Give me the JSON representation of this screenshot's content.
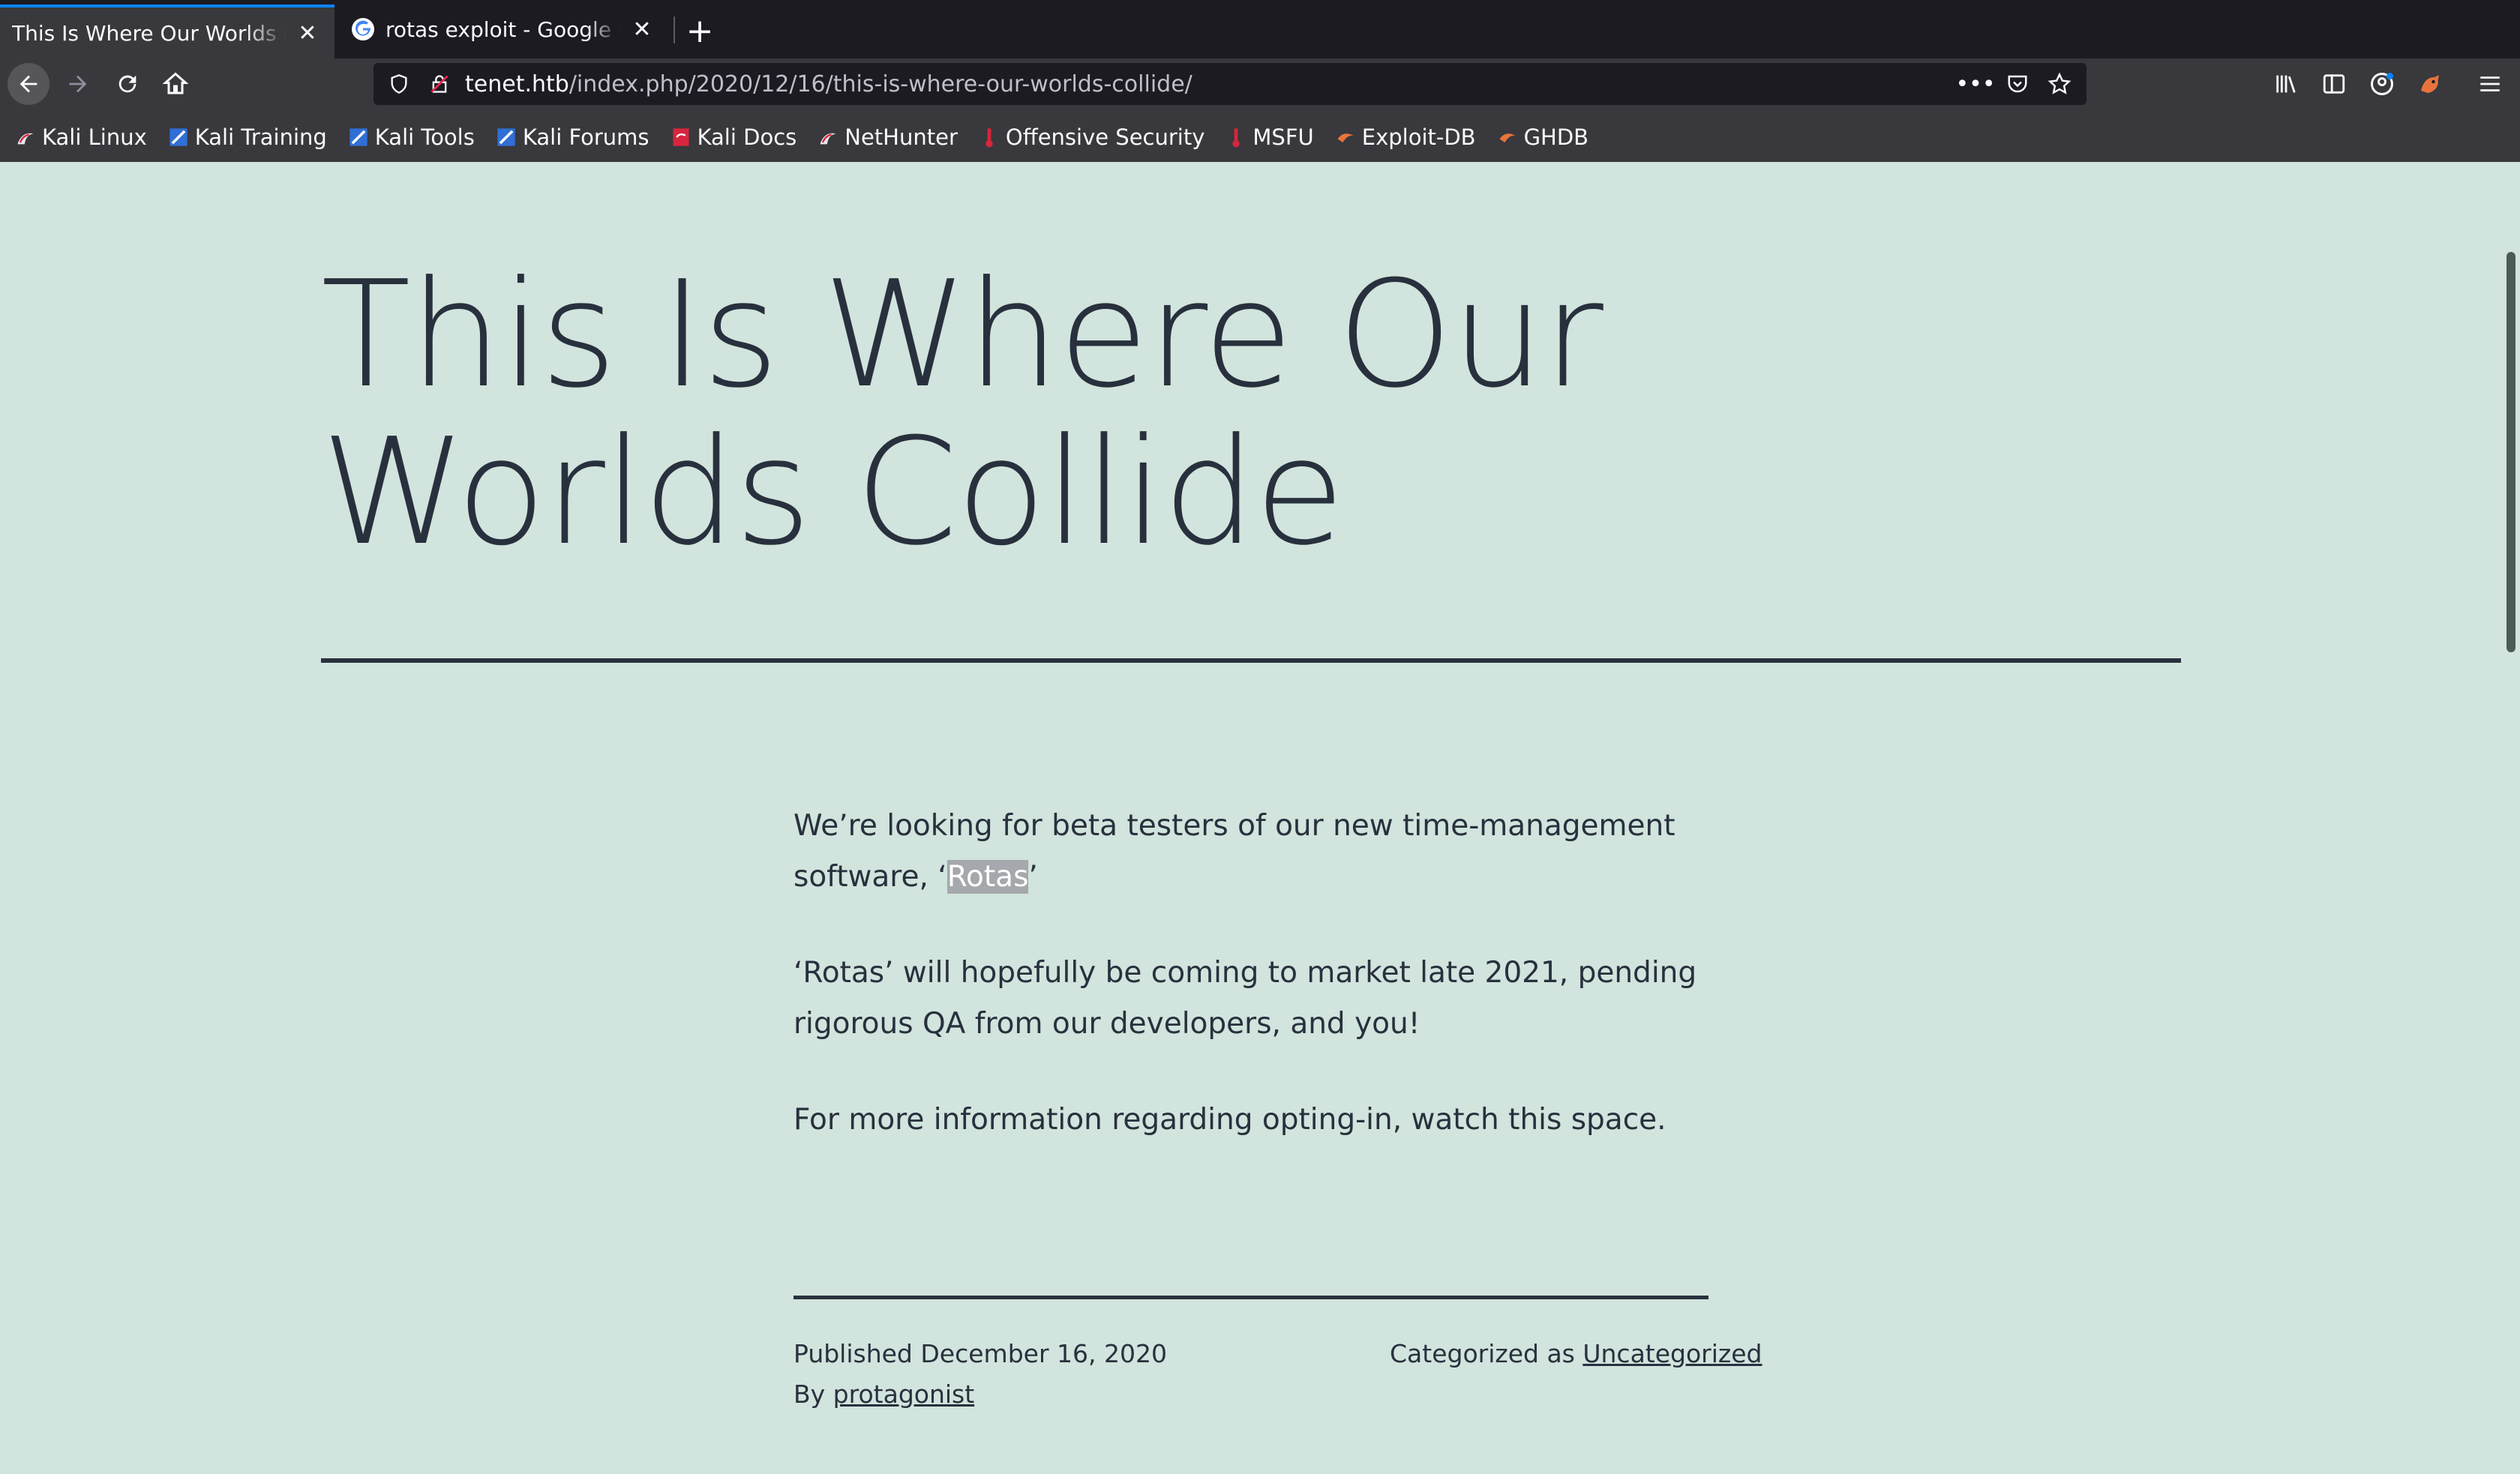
{
  "browser": {
    "tabs": [
      {
        "title": "This Is Where Our Worlds Collide",
        "active": true
      },
      {
        "title": "rotas exploit - Google Search",
        "active": false
      }
    ],
    "url_host": "tenet.htb",
    "url_path": "/index.php/2020/12/16/this-is-where-our-worlds-collide/",
    "bookmarks": [
      "Kali Linux",
      "Kali Training",
      "Kali Tools",
      "Kali Forums",
      "Kali Docs",
      "NetHunter",
      "Offensive Security",
      "MSFU",
      "Exploit-DB",
      "GHDB"
    ]
  },
  "post": {
    "title": "This Is Where Our Worlds Collide",
    "para1_before": "We’re looking for beta testers of our new time-management software, ‘",
    "para1_highlight": "Rotas",
    "para1_after": "’",
    "para2": "‘Rotas’ will hopefully be coming to market late 2021, pending rigorous QA from our developers, and you!",
    "para3": "For more information regarding opting-in, watch this space.",
    "published_label": "Published",
    "published_date": "December 16, 2020",
    "by_label": "By",
    "author": "protagonist",
    "category_label": "Categorized as",
    "category": "Uncategorized"
  },
  "colors": {
    "page_bg": "#d1e4dd",
    "text": "#28303d",
    "chrome": "#38383d",
    "accent": "#0a84ff"
  }
}
